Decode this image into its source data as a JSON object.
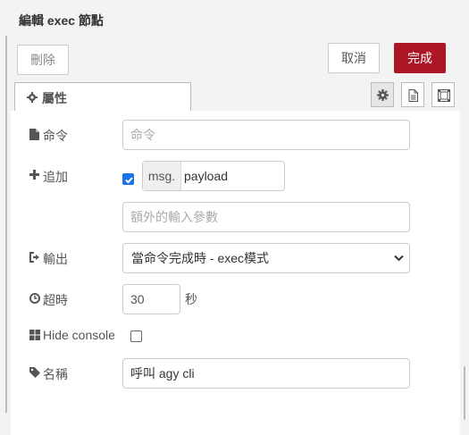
{
  "tray": {
    "title": "編輯 exec 節點"
  },
  "toolbar": {
    "delete_label": "刪除",
    "cancel_label": "取消",
    "done_label": "完成"
  },
  "tabs": {
    "properties_label": "屬性"
  },
  "form": {
    "command": {
      "label": "命令",
      "placeholder": "命令"
    },
    "append": {
      "label": "追加",
      "checked": true,
      "type_prefix": "msg.",
      "value": "payload",
      "extra_placeholder": "額外的輸入參數"
    },
    "output": {
      "label": "輸出",
      "selected": "當命令完成時 - exec模式"
    },
    "timeout": {
      "label": "超時",
      "value": "30",
      "unit": "秒"
    },
    "hide_console": {
      "label": "Hide console",
      "checked": false
    },
    "name": {
      "label": "名稱",
      "value": "呼叫 agy cli"
    }
  },
  "colors": {
    "primary_button": "#ad1625",
    "checkbox_on": "#1a73e8"
  }
}
